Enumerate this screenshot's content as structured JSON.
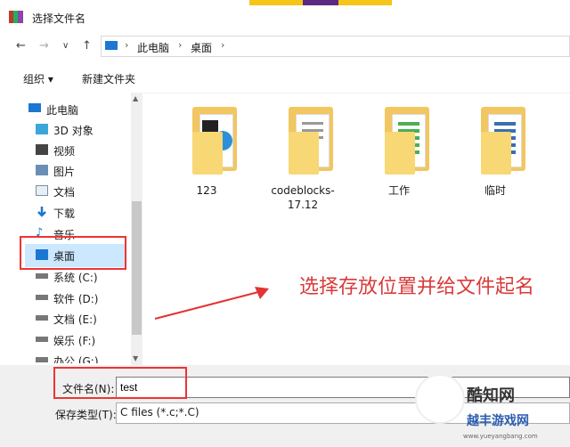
{
  "window": {
    "title": "选择文件名"
  },
  "nav": {
    "back": "←",
    "forward": "→",
    "dropdown": "∨",
    "up": "↑",
    "breadcrumbs": [
      "此电脑",
      "桌面"
    ],
    "sep": "›"
  },
  "toolbar": {
    "organize": "组织 ▾",
    "new_folder": "新建文件夹"
  },
  "sidebar": {
    "items": [
      {
        "label": "此电脑",
        "icon": "computer-icon"
      },
      {
        "label": "3D 对象",
        "icon": "cube-icon"
      },
      {
        "label": "视频",
        "icon": "video-icon"
      },
      {
        "label": "图片",
        "icon": "picture-icon"
      },
      {
        "label": "文档",
        "icon": "document-icon"
      },
      {
        "label": "下载",
        "icon": "download-icon"
      },
      {
        "label": "音乐",
        "icon": "music-icon"
      },
      {
        "label": "桌面",
        "icon": "desktop-icon"
      },
      {
        "label": "系统 (C:)",
        "icon": "drive-icon"
      },
      {
        "label": "软件 (D:)",
        "icon": "drive-icon"
      },
      {
        "label": "文档 (E:)",
        "icon": "drive-icon"
      },
      {
        "label": "娱乐 (F:)",
        "icon": "drive-icon"
      },
      {
        "label": "办公 (G:)",
        "icon": "drive-icon"
      }
    ]
  },
  "folders": [
    {
      "label": "123"
    },
    {
      "label": "codeblocks-17.12"
    },
    {
      "label": "工作"
    },
    {
      "label": "临时"
    }
  ],
  "annotation": {
    "text": "选择存放位置并给文件起名"
  },
  "filename": {
    "label": "文件名(N):",
    "value": "test"
  },
  "filetype": {
    "label": "保存类型(T):",
    "value": "C files (*.c;*.C)"
  },
  "watermark": {
    "name": "酷知网",
    "sub": "越丰游戏网",
    "url": "www.yueyangbang.com"
  },
  "colors": {
    "accent": "#1b77d1",
    "selection": "#cce8ff",
    "annotation": "#e33333",
    "folder": "#f2c660"
  }
}
